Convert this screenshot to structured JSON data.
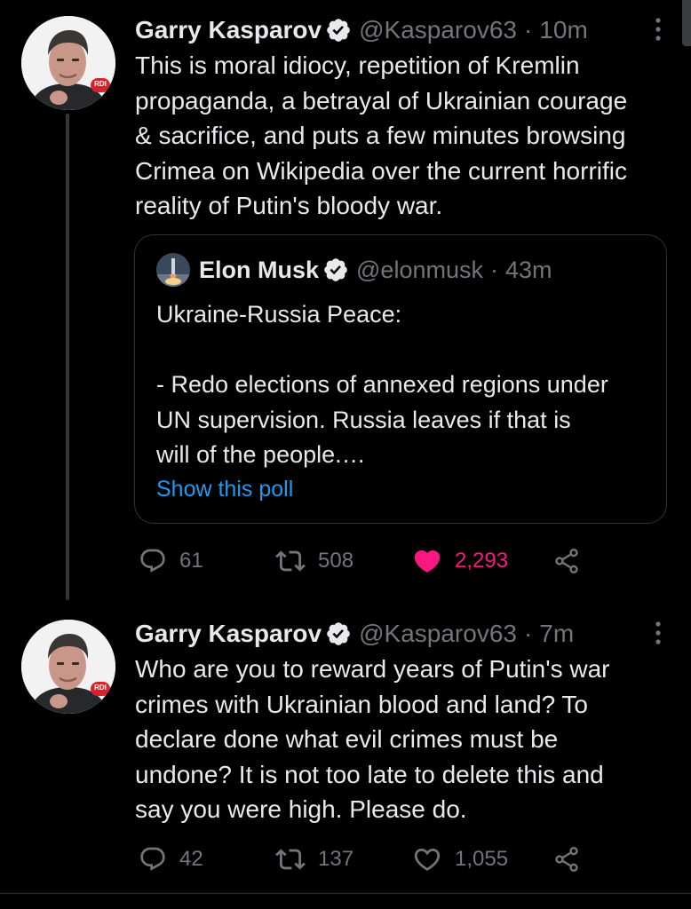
{
  "tweets": [
    {
      "author": {
        "name": "Garry Kasparov",
        "handle": "@Kasparov63",
        "avatar_badge": "RDI"
      },
      "separator": "·",
      "time": "10m",
      "text": "This is moral idiocy, repetition of Kremlin\npropaganda, a betrayal of Ukrainian courage\n& sacrifice, and puts a few minutes browsing\nCrimea on Wikipedia over the current horrific\nreality of Putin's bloody war.",
      "quote": {
        "author": {
          "name": "Elon Musk",
          "handle": "@elonmusk"
        },
        "separator": "·",
        "time": "43m",
        "text": "Ukraine-Russia Peace:\n\n- Redo elections of annexed regions under\nUN supervision. Russia leaves if that is\nwill of the people.…",
        "link_label": "Show this poll"
      },
      "metrics": {
        "replies": "61",
        "retweets": "508",
        "likes": "2,293",
        "liked": true
      }
    },
    {
      "author": {
        "name": "Garry Kasparov",
        "handle": "@Kasparov63",
        "avatar_badge": "RDI"
      },
      "separator": "·",
      "time": "7m",
      "text": "Who are you to reward years of Putin's war\ncrimes with Ukrainian blood and land? To\ndeclare done what evil crimes must be\nundone? It is not too late to delete this and\nsay you were high. Please do.",
      "metrics": {
        "replies": "42",
        "retweets": "137",
        "likes": "1,055",
        "liked": false
      }
    }
  ],
  "colors": {
    "background": "#000000",
    "text": "#e7e9ea",
    "muted": "#71767b",
    "link": "#1d9bf0",
    "like": "#f91880",
    "border": "#2f3336"
  }
}
